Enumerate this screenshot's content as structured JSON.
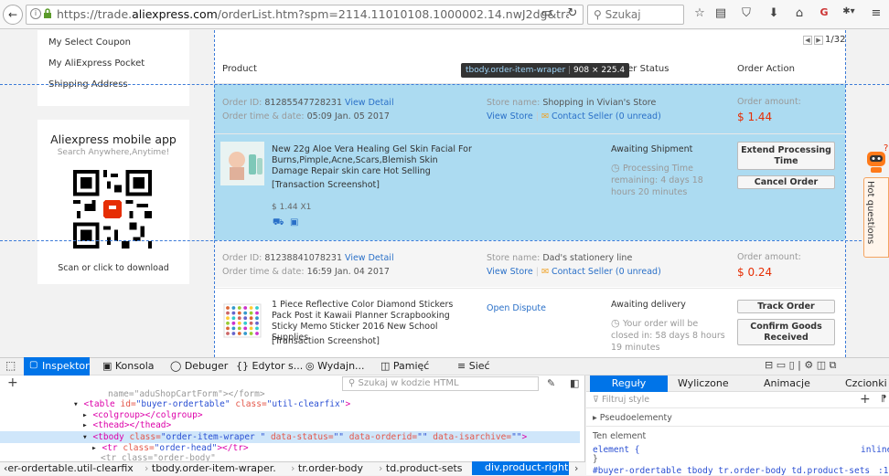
{
  "browser": {
    "back": "←",
    "url_prefix": "https://trade.",
    "url_domain": "aliexpress.com",
    "url_rest": "/orderList.htm?spm=2114.11010108.1000002.14.nwJ2dg&tracelog=ws_l",
    "search_placeholder": "Szukaj"
  },
  "sidebar": {
    "links": [
      "My Select Coupon",
      "My AliExpress Pocket",
      "Shipping Address"
    ],
    "mobile_title": "Aliexpress mobile app",
    "mobile_sub": "Search Anywhere,Anytime!",
    "scan_text": "Scan or click to download"
  },
  "table": {
    "pager": "1/32",
    "headers": {
      "product": "Product",
      "status": "Order Status",
      "action": "Order Action"
    }
  },
  "tooltip": {
    "selector": "tbody.order-item-wraper",
    "size": "908 × 225.4"
  },
  "orders": [
    {
      "id_label": "Order ID:",
      "id": "81285547728231",
      "view_detail": "View Detail",
      "time_label": "Order time & date:",
      "time": "05:09 Jan. 05 2017",
      "store_label": "Store name:",
      "store": "Shopping in Vivian's Store",
      "view_store": "View Store",
      "contact": "Contact Seller (0 unread)",
      "amount_label": "Order amount:",
      "amount": "$ 1.44",
      "product": "New 22g Aloe Vera Healing Gel Skin Facial For Burns,Pimple,Acne,Scars,Blemish Skin Damage Repair skin care Hot Selling",
      "snapshot": "[Transaction Screenshot]",
      "price": "$ 1.44 X1",
      "status": "Awaiting Shipment",
      "status_sub": "Processing Time remaining: 4 days 18 hours 20 minutes",
      "buttons": [
        "Extend Processing Time",
        "Cancel Order"
      ]
    },
    {
      "id_label": "Order ID:",
      "id": "81238841078231",
      "view_detail": "View Detail",
      "time_label": "Order time & date:",
      "time": "16:59 Jan. 04 2017",
      "store_label": "Store name:",
      "store": "Dad's stationery line",
      "view_store": "View Store",
      "contact": "Contact Seller (0 unread)",
      "amount_label": "Order amount:",
      "amount": "$ 0.24",
      "product": "1 Piece Reflective Color Diamond Stickers Pack Post it Kawaii Planner Scrapbooking Sticky Memo Sticker 2016 New School Supplies",
      "snapshot": "[Transaction Screenshot]",
      "dispute": "Open Dispute",
      "status": "Awaiting delivery",
      "status_sub": "Your order will be closed in: 58 days 8 hours 19 minutes",
      "buttons": [
        "Track Order",
        "Confirm Goods Received"
      ]
    }
  ],
  "help": "Hot questions",
  "devtools": {
    "tabs": [
      "Inspektor",
      "Konsola",
      "Debuger",
      "Edytor s...",
      "Wydajn...",
      "Pamięć",
      "Sieć"
    ],
    "search_placeholder": "Szukaj w kodzie HTML",
    "code": {
      "l1": "name=\"aduShopCartForm\"></form>",
      "l2_tag": "<table",
      "l2_a1": " id=",
      "l2_v1": "\"buyer-ordertable\"",
      "l2_a2": " class=",
      "l2_v2": "\"util-clearfix\"",
      "l2_end": ">",
      "l3": "<colgroup></colgroup>",
      "l4": "<thead></thead>",
      "l5_tag": "<tbody",
      "l5_a1": " class=",
      "l5_v1": "\"order-item-wraper \"",
      "l5_a2": " data-status=",
      "l5_v2": "\"\"",
      "l5_a3": " data-orderid=",
      "l5_v3": "\"\"",
      "l5_a4": " data-isarchive=",
      "l5_v4": "\"\"",
      "l5_end": ">",
      "l6_tag": "<tr",
      "l6_a1": " class=",
      "l6_v1": "\"order-head\"",
      "l6_end": "></tr>",
      "l7": "<tr class=\"order-body\""
    },
    "breadcrumb": [
      "er-ordertable.util-clearfix",
      "tbody.order-item-wraper.",
      "tr.order-body",
      "td.product-sets",
      "div.product-right"
    ],
    "right_tabs": [
      "Reguły",
      "Wyliczone",
      "Animacje",
      "Czcionki"
    ],
    "filter_placeholder": "Filtruj style",
    "pseudo": "Pseudoelementy",
    "this_element": "Ten element",
    "rule1_selector": "element {",
    "rule1_close": "}",
    "rule1_source": "inline",
    "rule2": "#buyer-ordertable tbody tr.order-body td.product-sets",
    "rule2_line": ":1"
  }
}
